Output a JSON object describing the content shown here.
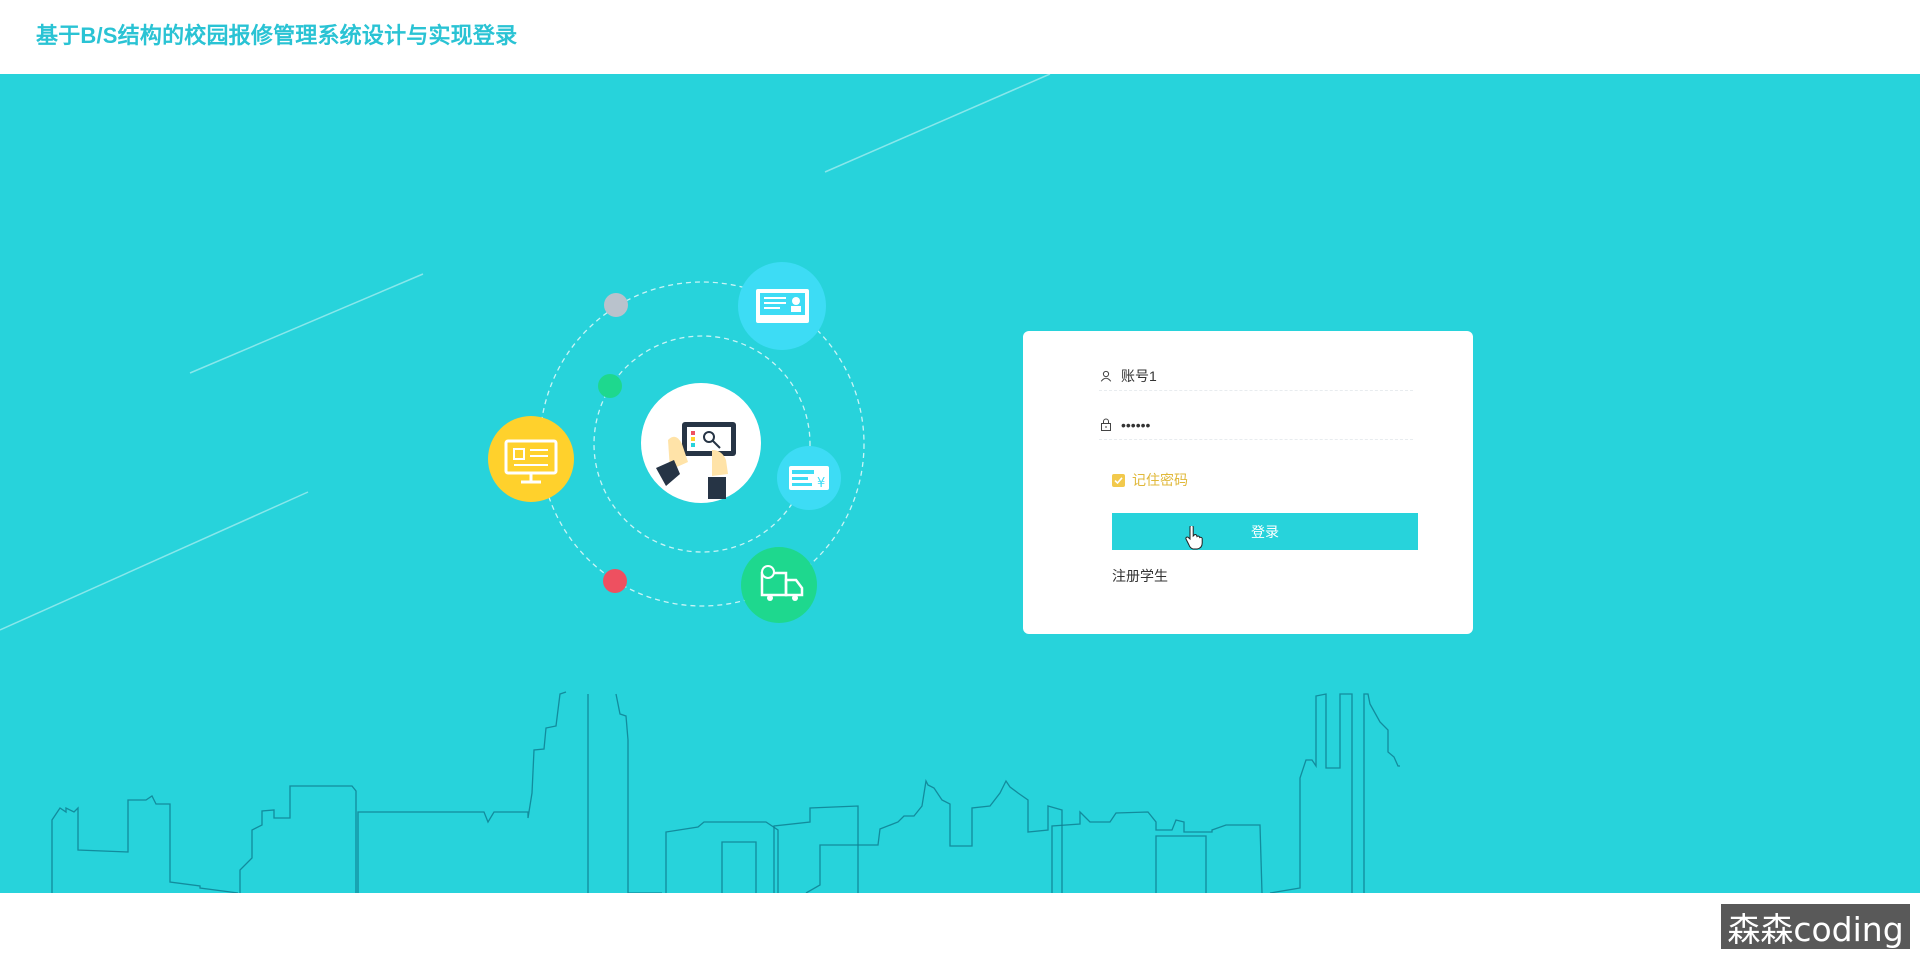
{
  "header": {
    "title": "基于B/S结构的校园报修管理系统设计与实现登录"
  },
  "login": {
    "username_value": "账号1",
    "password_value": "••••••",
    "remember_label": "记住密码",
    "remember_checked": true,
    "login_button": "登录",
    "register_link": "注册学生"
  },
  "watermark": "森森coding",
  "colors": {
    "primary": "#27d3db",
    "title": "#2ac3d4",
    "yellow": "#ffd12c",
    "green": "#1ed88e",
    "red": "#ee5060",
    "light_blue": "#3ddcf5"
  },
  "icons": [
    "user-icon",
    "lock-icon",
    "check-icon",
    "monitor-icon",
    "id-card-icon",
    "payment-card-icon",
    "delivery-truck-icon",
    "tablet-search-icon",
    "hand-pointer-icon"
  ]
}
